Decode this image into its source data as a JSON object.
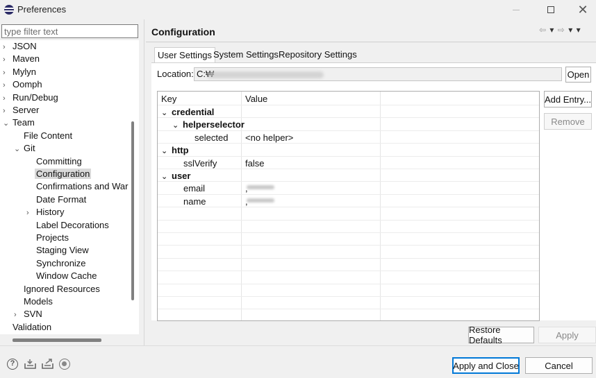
{
  "window": {
    "title": "Preferences",
    "minimize_glyph": "—",
    "maximize_glyph": "☐",
    "close_glyph": "✕"
  },
  "filter": {
    "placeholder": "type filter text",
    "value": ""
  },
  "tree": [
    {
      "label": "JSON",
      "level": 0,
      "toggle": "collapsed"
    },
    {
      "label": "Maven",
      "level": 0,
      "toggle": "collapsed"
    },
    {
      "label": "Mylyn",
      "level": 0,
      "toggle": "collapsed"
    },
    {
      "label": "Oomph",
      "level": 0,
      "toggle": "collapsed"
    },
    {
      "label": "Run/Debug",
      "level": 0,
      "toggle": "collapsed"
    },
    {
      "label": "Server",
      "level": 0,
      "toggle": "collapsed"
    },
    {
      "label": "Team",
      "level": 0,
      "toggle": "expanded"
    },
    {
      "label": "File Content",
      "level": 1,
      "toggle": "none"
    },
    {
      "label": "Git",
      "level": 1,
      "toggle": "expanded"
    },
    {
      "label": "Committing",
      "level": 2,
      "toggle": "none"
    },
    {
      "label": "Configuration",
      "level": 2,
      "toggle": "none",
      "selected": true
    },
    {
      "label": "Confirmations and Warr",
      "level": 2,
      "toggle": "none"
    },
    {
      "label": "Date Format",
      "level": 2,
      "toggle": "none"
    },
    {
      "label": "History",
      "level": 2,
      "toggle": "collapsed"
    },
    {
      "label": "Label Decorations",
      "level": 2,
      "toggle": "none"
    },
    {
      "label": "Projects",
      "level": 2,
      "toggle": "none"
    },
    {
      "label": "Staging View",
      "level": 2,
      "toggle": "none"
    },
    {
      "label": "Synchronize",
      "level": 2,
      "toggle": "none"
    },
    {
      "label": "Window Cache",
      "level": 2,
      "toggle": "none"
    },
    {
      "label": "Ignored Resources",
      "level": 1,
      "toggle": "none"
    },
    {
      "label": "Models",
      "level": 1,
      "toggle": "none"
    },
    {
      "label": "SVN",
      "level": 1,
      "toggle": "collapsed"
    },
    {
      "label": "Validation",
      "level": 0,
      "toggle": "none"
    }
  ],
  "page": {
    "title": "Configuration",
    "nav": {
      "back": "⇦",
      "forward": "⇨",
      "dropdown": "▾",
      "menu": "▾"
    },
    "tabs": [
      {
        "label": "User Settings",
        "active": true
      },
      {
        "label": "System Settings",
        "active": false
      },
      {
        "label": "Repository Settings",
        "active": false
      }
    ],
    "location": {
      "label": "Location:",
      "value": "C:₩"
    },
    "open_label": "Open",
    "table": {
      "headers": {
        "key": "Key",
        "value": "Value"
      },
      "rows": [
        {
          "key": "credential",
          "value": "",
          "level": 0,
          "section": true
        },
        {
          "key": "helperselector",
          "value": "",
          "level": 1,
          "section": true
        },
        {
          "key": "selected",
          "value": "<no helper>",
          "level": 2,
          "section": false
        },
        {
          "key": "http",
          "value": "",
          "level": 0,
          "section": true
        },
        {
          "key": "sslVerify",
          "value": "false",
          "level": 1,
          "section": false
        },
        {
          "key": "user",
          "value": "",
          "level": 0,
          "section": true
        },
        {
          "key": "email",
          "value": ",",
          "level": 1,
          "section": false,
          "redacted": true
        },
        {
          "key": "name",
          "value": ",",
          "level": 1,
          "section": false,
          "redacted": true
        }
      ]
    },
    "add_entry_label": "Add Entry...",
    "remove_label": "Remove",
    "restore_defaults_label": "Restore Defaults",
    "apply_label": "Apply"
  },
  "footer": {
    "help_glyph": "?",
    "apply_close_label": "Apply and Close",
    "cancel_label": "Cancel"
  },
  "icons": {
    "expanded": "⌄",
    "collapsed": "›"
  }
}
